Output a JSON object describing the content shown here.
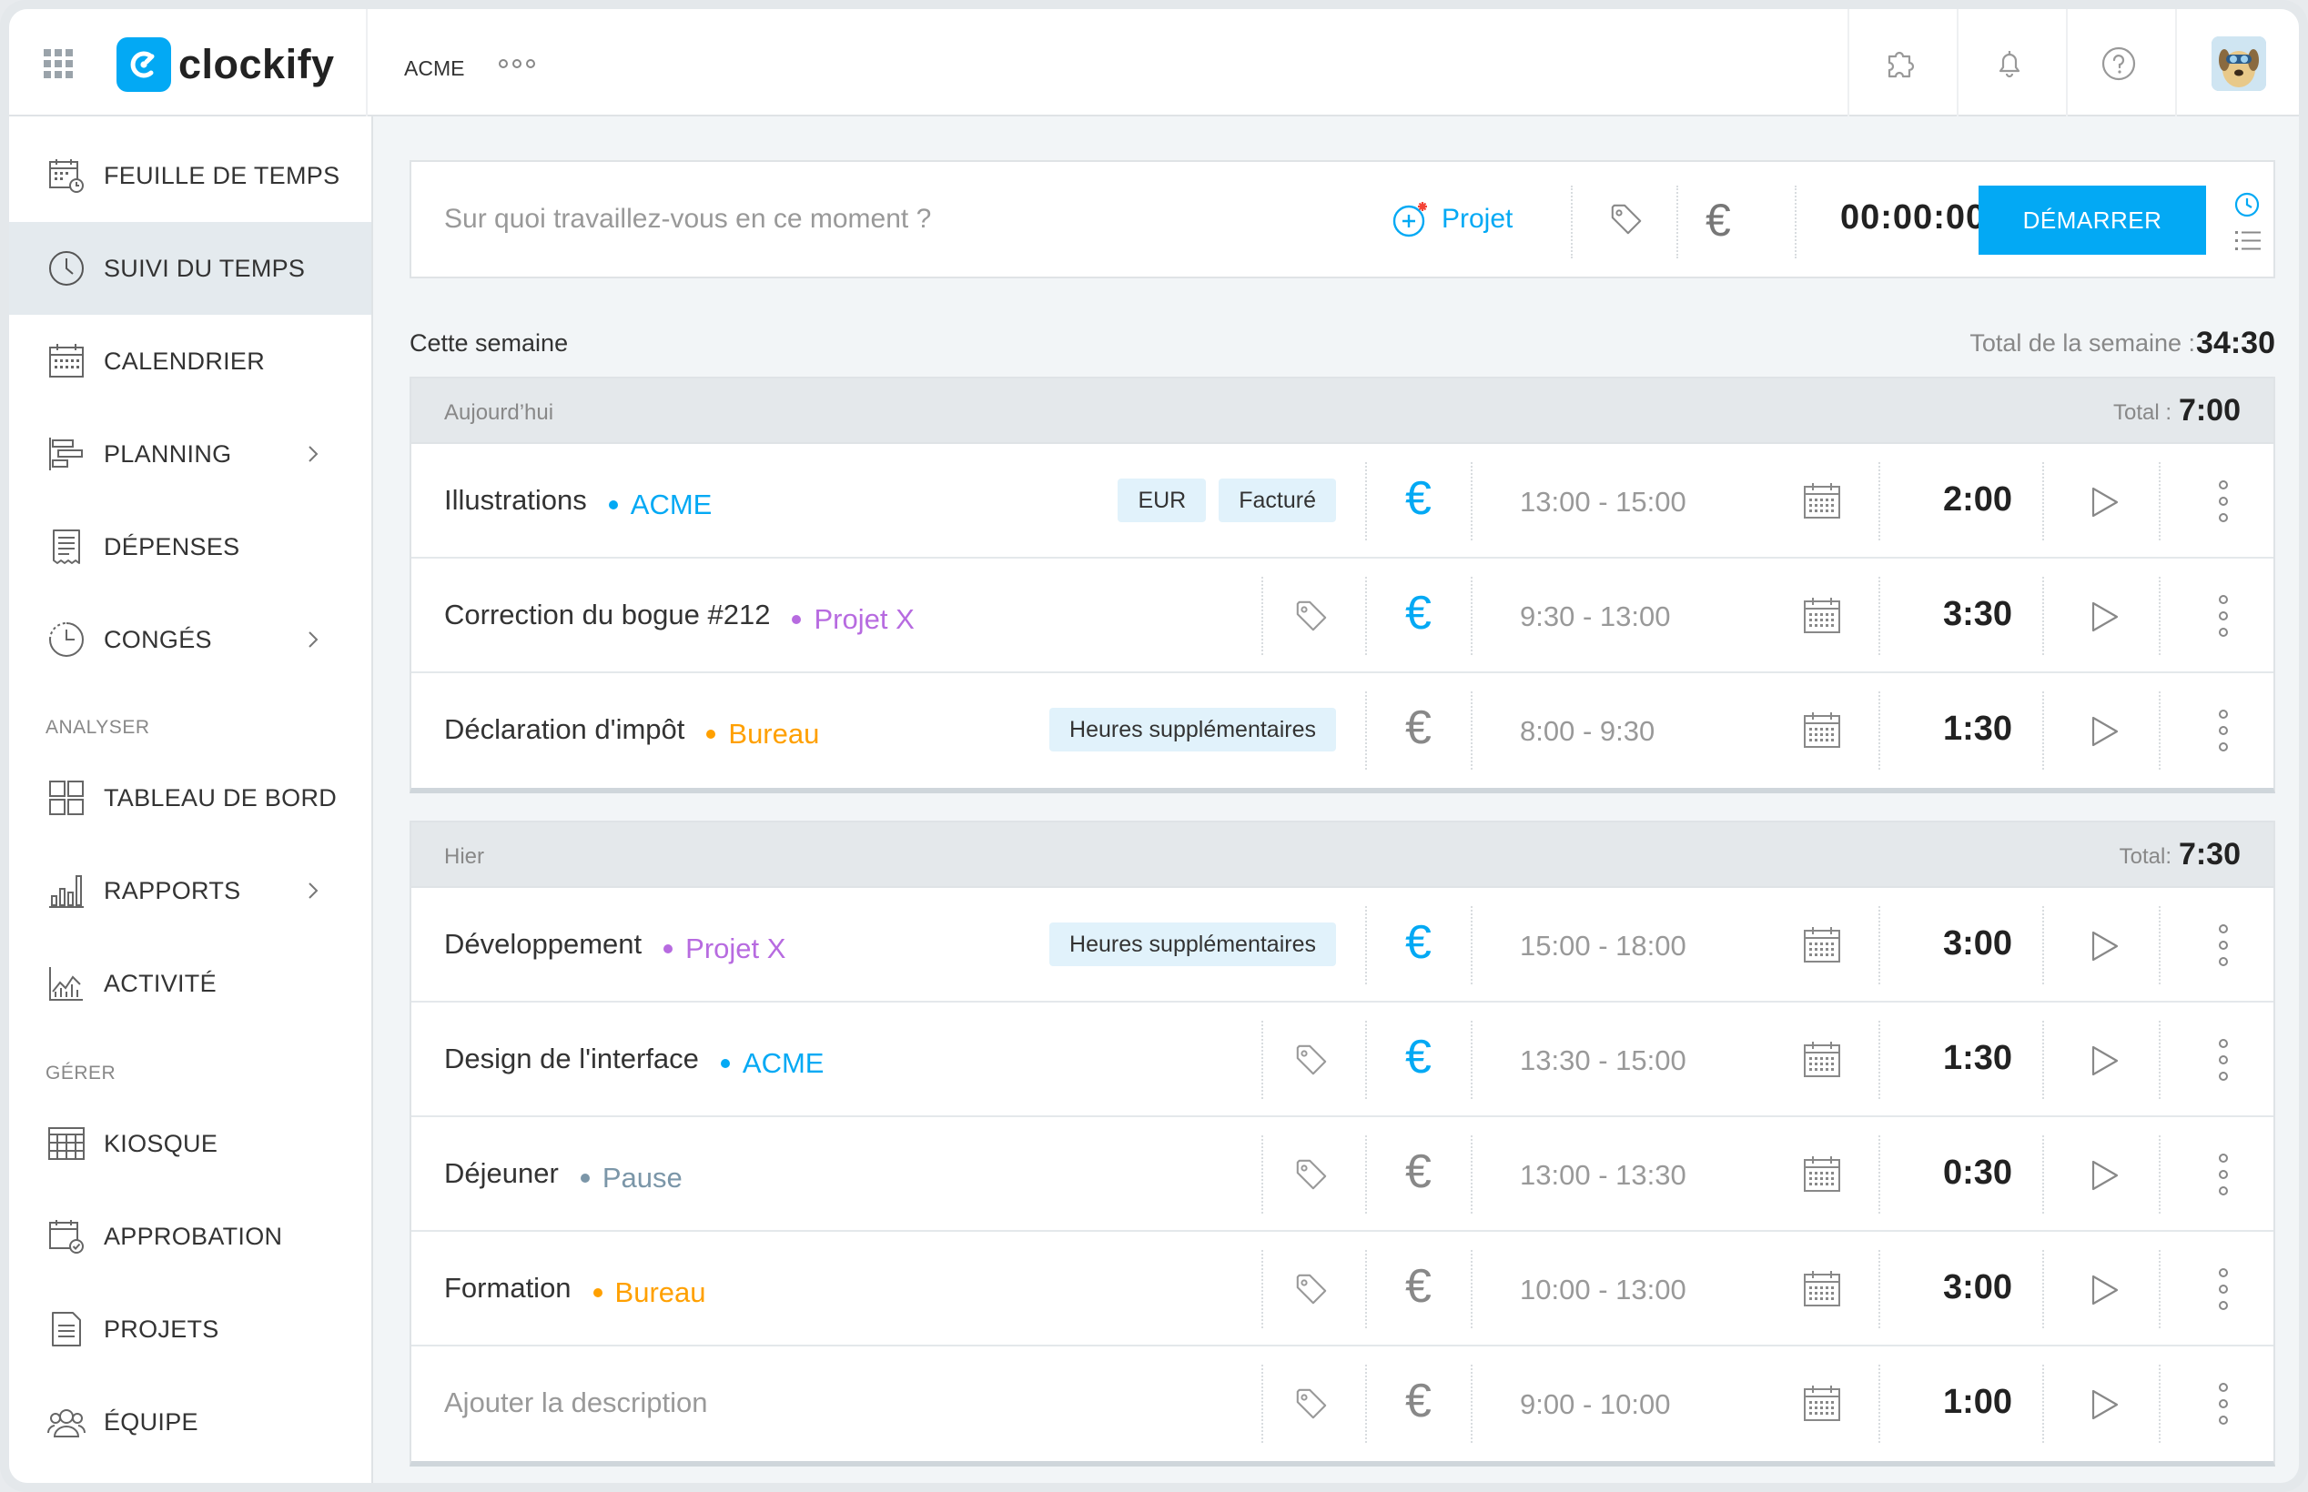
{
  "brand": {
    "name": "clockify",
    "accent": "#03a9f4"
  },
  "header": {
    "workspace": "ACME"
  },
  "sidebar": {
    "items": [
      {
        "label": "FEUILLE DE TEMPS",
        "icon": "timesheet-icon"
      },
      {
        "label": "SUIVI DU TEMPS",
        "icon": "clock-icon",
        "active": true
      },
      {
        "label": "CALENDRIER",
        "icon": "calendar-icon"
      },
      {
        "label": "PLANNING",
        "icon": "planning-icon",
        "has_submenu": true
      },
      {
        "label": "DÉPENSES",
        "icon": "receipt-icon"
      },
      {
        "label": "CONGÉS",
        "icon": "time-off-icon",
        "has_submenu": true
      }
    ],
    "section_analyze": "ANALYSER",
    "analyze_items": [
      {
        "label": "TABLEAU DE BORD",
        "icon": "dashboard-icon"
      },
      {
        "label": "RAPPORTS",
        "icon": "reports-icon",
        "has_submenu": true
      },
      {
        "label": "ACTIVITÉ",
        "icon": "activity-icon"
      }
    ],
    "section_manage": "GÉRER",
    "manage_items": [
      {
        "label": "KIOSQUE",
        "icon": "kiosk-icon"
      },
      {
        "label": "APPROBATION",
        "icon": "approval-icon"
      },
      {
        "label": "PROJETS",
        "icon": "projects-icon"
      },
      {
        "label": "ÉQUIPE",
        "icon": "team-icon"
      }
    ]
  },
  "timer": {
    "placeholder": "Sur quoi travaillez-vous en ce moment ?",
    "project_label": "Projet",
    "currency": "€",
    "elapsed": "00:00:00",
    "start_label": "DÉMARRER"
  },
  "week": {
    "label": "Cette semaine",
    "total_label": "Total de la semaine :",
    "total": "34:30"
  },
  "days": [
    {
      "label": "Aujourd’hui",
      "total_label": "Total :",
      "total": "7:00",
      "entries": [
        {
          "description": "Illustrations",
          "project": "ACME",
          "project_color": "#03a9f4",
          "tags": [
            "EUR",
            "Facturé"
          ],
          "billable": true,
          "range": "13:00 - 15:00",
          "duration": "2:00"
        },
        {
          "description": "Correction du bogue #212",
          "project": "Projet X",
          "project_color": "#b76be0",
          "tags": [],
          "billable": true,
          "range": "9:30 - 13:00",
          "duration": "3:30"
        },
        {
          "description": "Déclaration d'impôt",
          "project": "Bureau",
          "project_color": "#ffa000",
          "tags": [
            "Heures supplémentaires"
          ],
          "billable": false,
          "range": "8:00 - 9:30",
          "duration": "1:30"
        }
      ]
    },
    {
      "label": "Hier",
      "total_label": "Total:",
      "total": "7:30",
      "entries": [
        {
          "description": "Développement",
          "project": "Projet X",
          "project_color": "#b76be0",
          "tags": [
            "Heures supplémentaires"
          ],
          "billable": true,
          "range": "15:00 - 18:00",
          "duration": "3:00"
        },
        {
          "description": "Design de l'interface",
          "project": "ACME",
          "project_color": "#03a9f4",
          "tags": [],
          "billable": true,
          "range": "13:30 - 15:00",
          "duration": "1:30"
        },
        {
          "description": "Déjeuner",
          "project": "Pause",
          "project_color": "#7b96a8",
          "tags": [],
          "billable": false,
          "range": "13:00 - 13:30",
          "duration": "0:30"
        },
        {
          "description": "Formation",
          "project": "Bureau",
          "project_color": "#ffa000",
          "tags": [],
          "billable": false,
          "range": "10:00 - 13:00",
          "duration": "3:00"
        },
        {
          "description": "",
          "placeholder": "Ajouter la description",
          "project": "",
          "tags": [],
          "billable": false,
          "range": "9:00 - 10:00",
          "duration": "1:00"
        }
      ]
    }
  ]
}
